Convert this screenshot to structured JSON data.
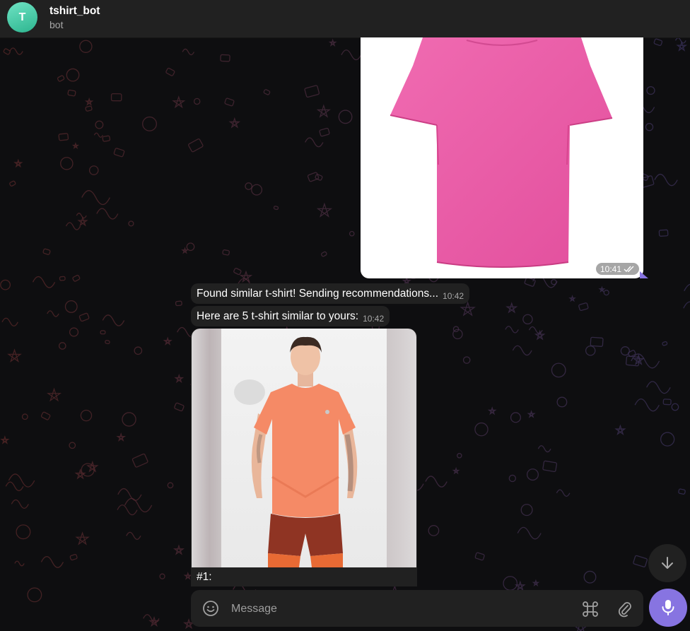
{
  "header": {
    "avatar_letter": "T",
    "title": "tshirt_bot",
    "subtitle": "bot"
  },
  "outgoing_photo": {
    "alt": "pink t-shirt",
    "time": "10:41",
    "status_icon": "double-check-icon"
  },
  "messages": [
    {
      "text": "Found similar t-shirt! Sending recommendations...",
      "time": "10:42"
    },
    {
      "text": "Here are 5 t-shirt similar to yours:",
      "time": "10:42"
    }
  ],
  "recommendation": {
    "caption": "#1:",
    "alt": "man in orange t-shirt"
  },
  "composer": {
    "placeholder": "Message",
    "emoji_icon": "emoji-icon",
    "commands_icon": "command-icon",
    "attach_icon": "paperclip-icon",
    "mic_icon": "microphone-icon"
  },
  "scroll_down_icon": "arrow-down-icon",
  "colors": {
    "accent": "#8774e1",
    "bubble": "#212121",
    "header": "#212121",
    "pink_shirt": "#ea5aa6",
    "orange_shirt": "#f58a66"
  }
}
